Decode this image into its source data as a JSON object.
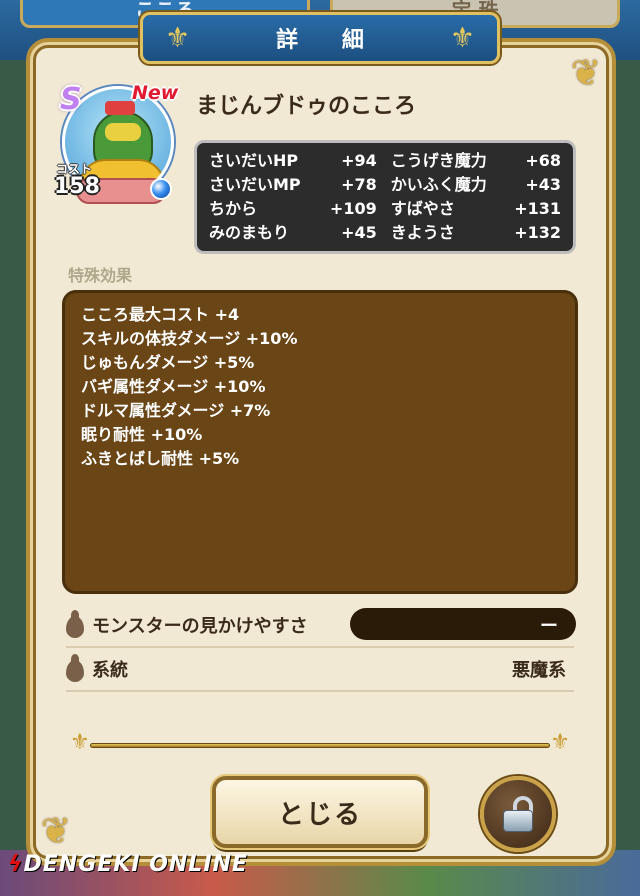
{
  "background_tabs": [
    "こころ",
    "宝 珠"
  ],
  "dialog": {
    "title": "詳 細"
  },
  "heart": {
    "rank": "S",
    "badge": "New",
    "cost_label": "コスト",
    "cost": "158",
    "name": "まじんブドゥのこころ"
  },
  "stats": [
    {
      "label": "さいだいHP",
      "value": "+94",
      "label2": "こうげき魔力",
      "value2": "+68"
    },
    {
      "label": "さいだいMP",
      "value": "+78",
      "label2": "かいふく魔力",
      "value2": "+43"
    },
    {
      "label": "ちから",
      "value": "+109",
      "label2": "すばやさ",
      "value2": "+131"
    },
    {
      "label": "みのまもり",
      "value": "+45",
      "label2": "きようさ",
      "value2": "+132"
    }
  ],
  "effects": {
    "label": "特殊効果",
    "items": [
      "こころ最大コスト +4",
      "スキルの体技ダメージ +10%",
      "じゅもんダメージ +5%",
      "バギ属性ダメージ +10%",
      "ドルマ属性ダメージ +7%",
      "眠り耐性 +10%",
      "ふきとばし耐性 +5%"
    ]
  },
  "info": {
    "visibility_label": "モンスターの見かけやすさ",
    "visibility_value": "ー",
    "lineage_label": "系統",
    "lineage_value": "悪魔系"
  },
  "buttons": {
    "close_label": "とじる"
  },
  "watermark": "DENGEKI ONLINE",
  "colors": {
    "frame_gold": "#b58e3a",
    "panel_bg": "#f1e9d4",
    "effects_bg": "#6a4516",
    "stats_bg": "#2c2c2c",
    "title_blue": "#2a6ca8"
  }
}
